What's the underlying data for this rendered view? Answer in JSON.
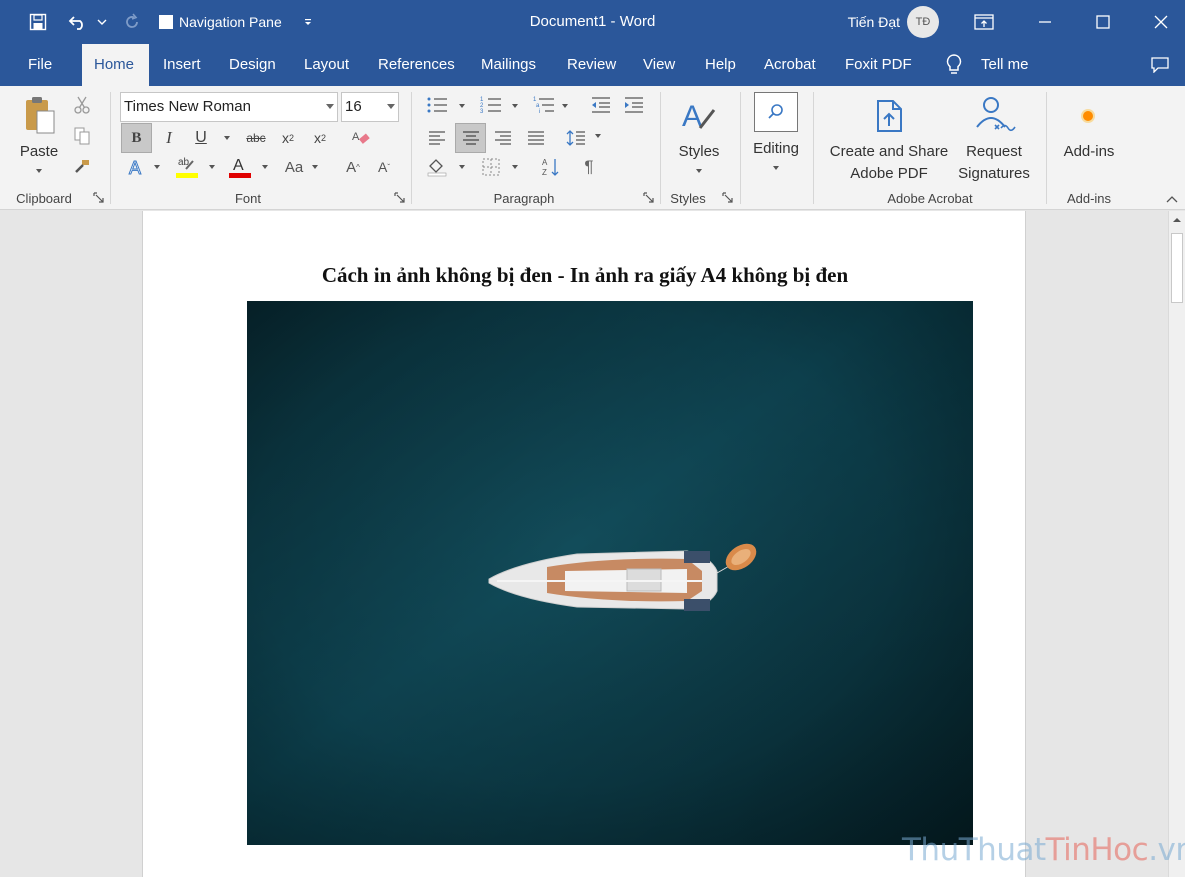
{
  "titlebar": {
    "quick_access": {
      "nav_pane_label": "Navigation Pane"
    },
    "doc_title": "Document1  -  Word",
    "user_name": "Tiến Đạt",
    "avatar_initials": "TĐ"
  },
  "tabs": [
    {
      "label": "File"
    },
    {
      "label": "Home",
      "active": true
    },
    {
      "label": "Insert"
    },
    {
      "label": "Design"
    },
    {
      "label": "Layout"
    },
    {
      "label": "References"
    },
    {
      "label": "Mailings"
    },
    {
      "label": "Review"
    },
    {
      "label": "View"
    },
    {
      "label": "Help"
    },
    {
      "label": "Acrobat"
    },
    {
      "label": "Foxit PDF"
    }
  ],
  "tell_me": "Tell me",
  "ribbon": {
    "clipboard": {
      "paste_label": "Paste",
      "group_label": "Clipboard"
    },
    "font": {
      "font_name": "Times New Roman",
      "font_size": "16",
      "group_label": "Font"
    },
    "paragraph": {
      "group_label": "Paragraph"
    },
    "styles": {
      "styles_label": "Styles",
      "group_label": "Styles"
    },
    "editing": {
      "editing_label": "Editing"
    },
    "acrobat": {
      "create_share_line1": "Create and Share",
      "create_share_line2": "Adobe PDF",
      "request_line1": "Request",
      "request_line2": "Signatures",
      "group_label": "Adobe Acrobat"
    },
    "addins": {
      "addins_label": "Add-ins",
      "group_label": "Add-ins"
    }
  },
  "document": {
    "heading": "Cách in ảnh không bị đen - In ảnh ra giấy A4 không bị đen"
  },
  "watermark": {
    "part1": "ThuThuat",
    "part2": "TinHoc",
    "part3": ".vn"
  },
  "colors": {
    "brand": "#2b579a",
    "highlight": "#ffff00",
    "font_color": "#e00000",
    "sea": "#0d4654"
  }
}
